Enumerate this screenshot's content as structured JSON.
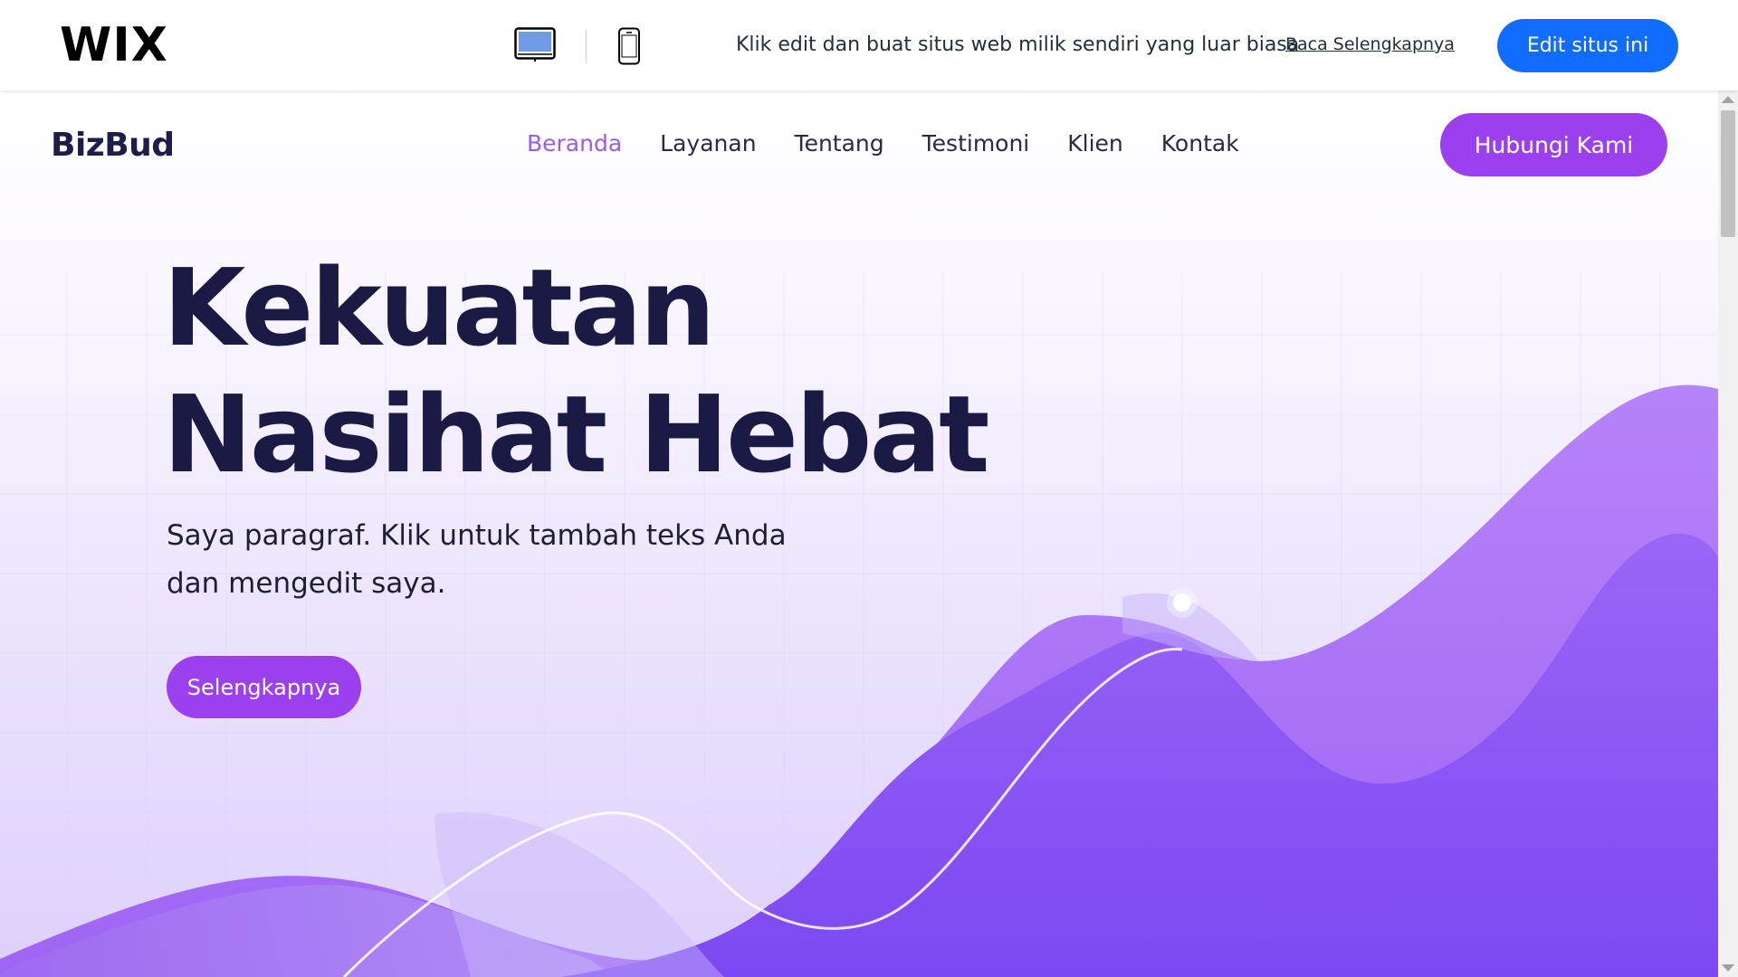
{
  "wix_bar": {
    "logo": "WIX",
    "message": "Klik edit dan buat situs web milik sendiri yang luar biasa",
    "read_more": "Baca Selengkapnya",
    "edit_button": "Edit situs ini",
    "accent_color": "#116dff",
    "icons": [
      "desktop-icon",
      "mobile-icon"
    ]
  },
  "site": {
    "brand": "BizBud",
    "nav": [
      {
        "label": "Beranda",
        "active": true
      },
      {
        "label": "Layanan",
        "active": false
      },
      {
        "label": "Tentang",
        "active": false
      },
      {
        "label": "Testimoni",
        "active": false
      },
      {
        "label": "Klien",
        "active": false
      },
      {
        "label": "Kontak",
        "active": false
      }
    ],
    "contact_button": "Hubungi Kami",
    "accent_color": "#9a40ef",
    "hero": {
      "title_line1": "Kekuatan",
      "title_line2": "Nasihat Hebat",
      "paragraph_line1": "Saya paragraf. Klik untuk tambah teks Anda",
      "paragraph_line2": "dan mengedit saya.",
      "button": "Selengkapnya"
    }
  }
}
